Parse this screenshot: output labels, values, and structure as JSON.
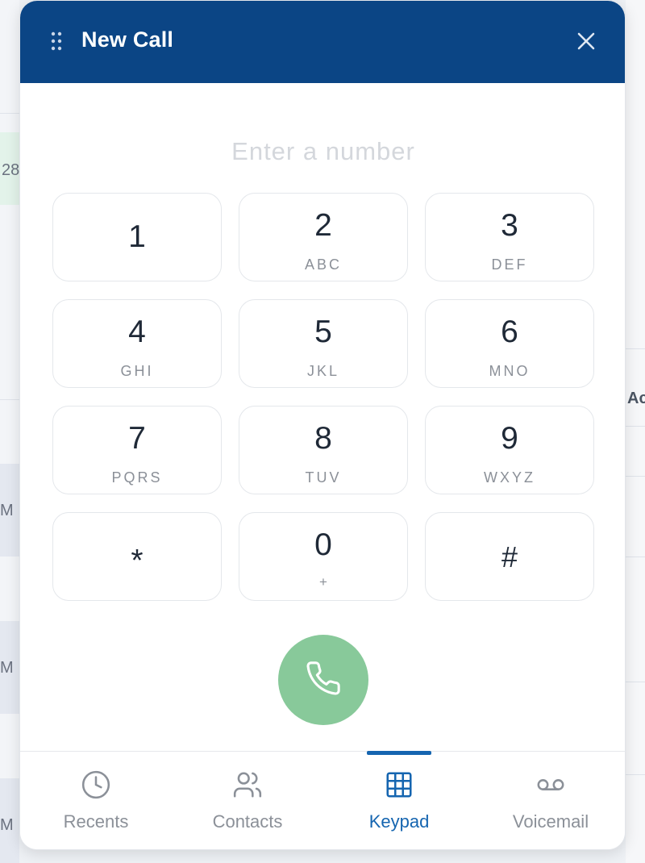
{
  "header": {
    "title": "New Call",
    "drag_icon": "drag-handle-icon",
    "close_icon": "close-icon"
  },
  "input": {
    "placeholder": "Enter a number",
    "value": ""
  },
  "keys": [
    {
      "digit": "1",
      "letters": ""
    },
    {
      "digit": "2",
      "letters": "ABC"
    },
    {
      "digit": "3",
      "letters": "DEF"
    },
    {
      "digit": "4",
      "letters": "GHI"
    },
    {
      "digit": "5",
      "letters": "JKL"
    },
    {
      "digit": "6",
      "letters": "MNO"
    },
    {
      "digit": "7",
      "letters": "PQRS"
    },
    {
      "digit": "8",
      "letters": "TUV"
    },
    {
      "digit": "9",
      "letters": "WXYZ"
    },
    {
      "digit": "*",
      "letters": ""
    },
    {
      "digit": "0",
      "letters": "+"
    },
    {
      "digit": "#",
      "letters": ""
    }
  ],
  "call_button": {
    "icon": "phone-icon",
    "color": "#88c99a"
  },
  "tabs": [
    {
      "label": "Recents",
      "icon": "clock-icon",
      "active": false
    },
    {
      "label": "Contacts",
      "icon": "contacts-icon",
      "active": false
    },
    {
      "label": "Keypad",
      "icon": "keypad-grid-icon",
      "active": true
    },
    {
      "label": "Voicemail",
      "icon": "voicemail-icon",
      "active": false
    }
  ],
  "colors": {
    "header": "#0b4585",
    "accent": "#1565b0",
    "call": "#88c99a"
  },
  "background": {
    "fragments": [
      "28",
      "M",
      "M",
      "M",
      "Act"
    ]
  }
}
